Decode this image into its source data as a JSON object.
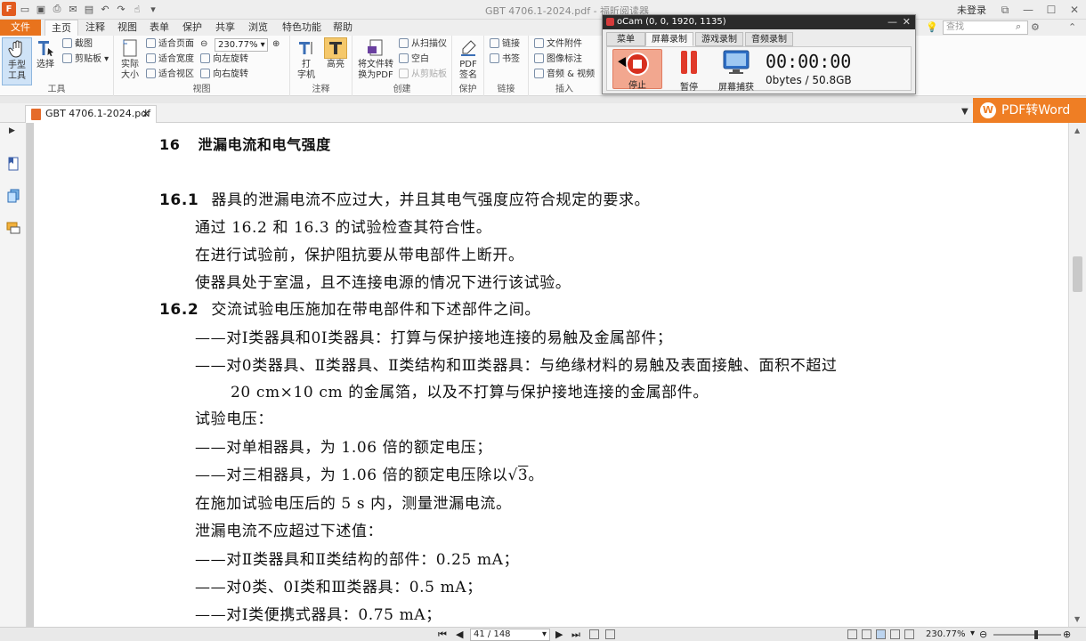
{
  "window": {
    "title": "GBT 4706.1-2024.pdf - 福昕阅读器",
    "login": "未登录"
  },
  "ribbon_tabs": [
    "文件",
    "主页",
    "注释",
    "视图",
    "表单",
    "保护",
    "共享",
    "浏览",
    "特色功能",
    "帮助"
  ],
  "search": {
    "placeholder": "查找"
  },
  "ribbon": {
    "tools": {
      "label": "工具",
      "hand": "手型\n工具",
      "select": "选择",
      "screenshot": "截图",
      "clipboard": "剪贴板"
    },
    "view": {
      "label": "视图",
      "actual": "实际\n大小",
      "fit_page": "适合页面",
      "fit_width": "适合宽度",
      "fit_view": "适合视区",
      "zoom": "230.77%",
      "rotate_left": "向左旋转",
      "rotate_right": "向右旋转"
    },
    "annot": {
      "label": "注释",
      "typewriter": "打\n字机",
      "highlight": "高亮"
    },
    "create": {
      "label": "创建",
      "convert": "将文件转\n换为PDF",
      "from_scanner": "从扫描仪",
      "blank": "空白",
      "from_clipboard": "从剪贴板"
    },
    "protect": {
      "label": "保护",
      "sign": "PDF\n签名"
    },
    "links": {
      "label": "链接",
      "link": "链接",
      "bookmark": "书签"
    },
    "insert": {
      "label": "插入",
      "attach": "文件附件",
      "image": "图像标注",
      "av": "音频 & 视频"
    }
  },
  "doc_tab": {
    "name": "GBT 4706.1-2024.pdf"
  },
  "pdf2word": "PDF转Word",
  "document": {
    "heading": {
      "num": "16",
      "text": "泄漏电流和电气强度"
    },
    "lines": [
      {
        "sec": "16.1",
        "text": "器具的泄漏电流不应过大，并且其电气强度应符合规定的要求。"
      },
      {
        "text": "通过 16.2 和 16.3 的试验检查其符合性。"
      },
      {
        "text": "在进行试验前，保护阻抗要从带电部件上断开。"
      },
      {
        "text": "使器具处于室温，且不连接电源的情况下进行该试验。"
      },
      {
        "sec": "16.2",
        "text": "交流试验电压施加在带电部件和下述部件之间。"
      },
      {
        "text": "——对Ⅰ类器具和0Ⅰ类器具：打算与保护接地连接的易触及金属部件；"
      },
      {
        "text": "——对0类器具、Ⅱ类器具、Ⅱ类结构和Ⅲ类器具：与绝缘材料的易触及表面接触、面积不超过"
      },
      {
        "text": "20 cm×10 cm 的金属箔，以及不打算与保护接地连接的金属部件。"
      },
      {
        "text": "试验电压："
      },
      {
        "text": "——对单相器具，为 1.06 倍的额定电压；"
      },
      {
        "text": "——对三相器具，为 1.06 倍的额定电压除以",
        "sqrt": "3",
        "tail": "。"
      },
      {
        "text": "在施加试验电压后的 5 s 内，测量泄漏电流。"
      },
      {
        "text": "泄漏电流不应超过下述值："
      },
      {
        "text": "——对Ⅱ类器具和Ⅱ类结构的部件：0.25 mA；"
      },
      {
        "text": "——对0类、0Ⅰ类和Ⅲ类器具：0.5 mA；"
      },
      {
        "text": "——对Ⅰ类便携式器具：0.75 mA；"
      }
    ]
  },
  "status": {
    "page": "41 / 148",
    "zoom": "230.77%"
  },
  "ocam": {
    "title": "oCam (0, 0, 1920, 1135)",
    "tabs": [
      "菜单",
      "屏幕录制",
      "游戏录制",
      "音频录制"
    ],
    "stop": "停止",
    "pause": "暂停",
    "capture": "屏幕捕获",
    "timer": "00:00:00",
    "size": "0bytes / 50.8GB"
  }
}
